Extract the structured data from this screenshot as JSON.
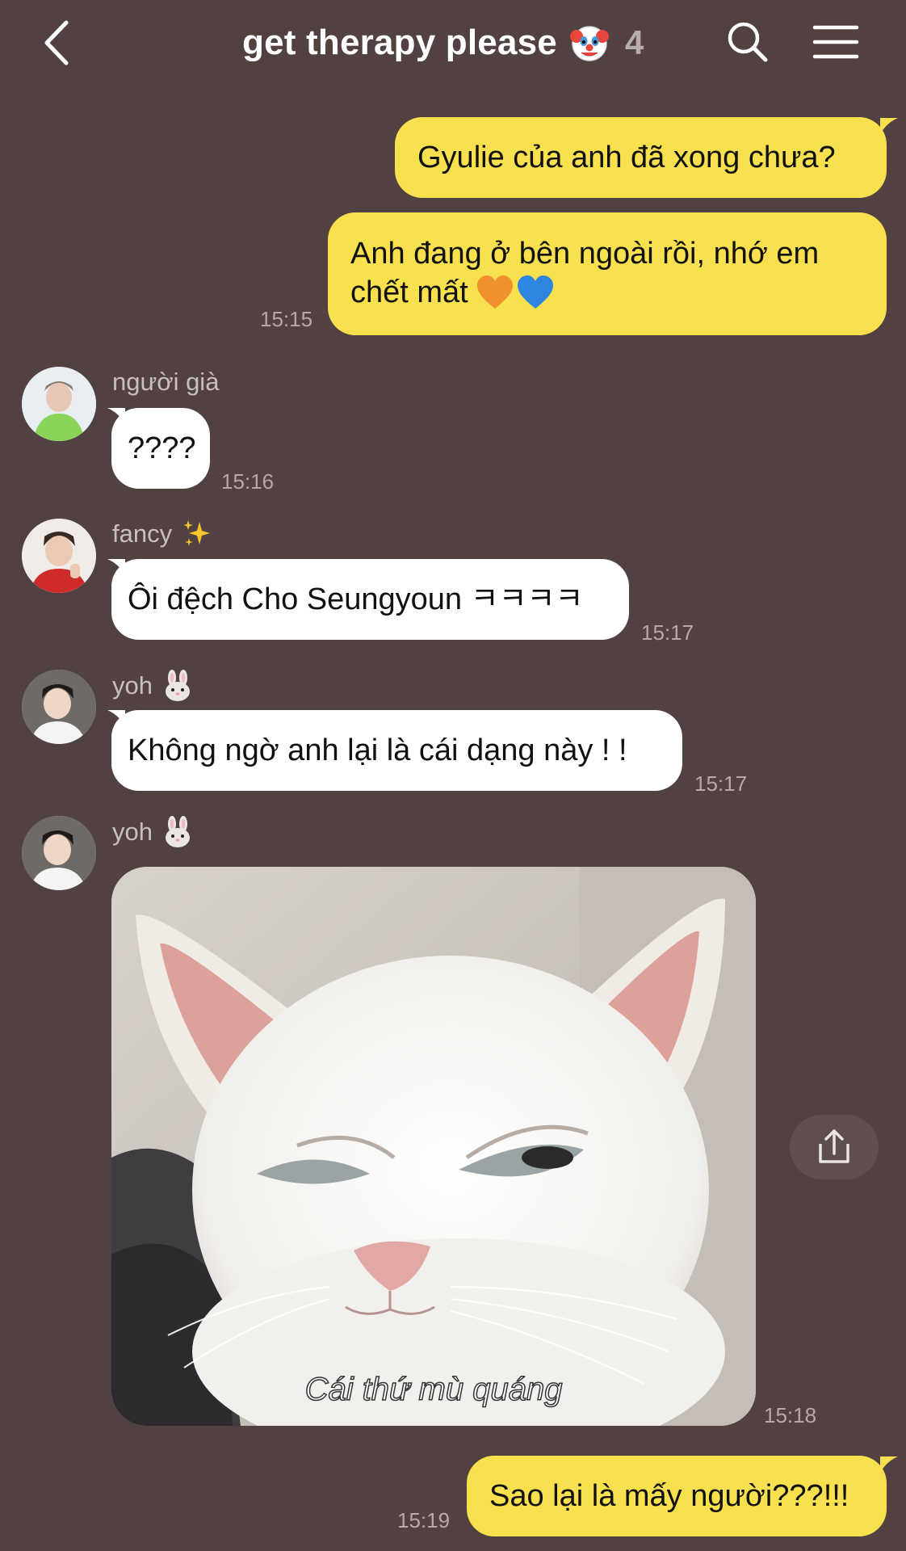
{
  "header": {
    "title": "get therapy please",
    "title_emoji": "clown-face-icon",
    "member_count": "4"
  },
  "messages": [
    {
      "direction": "out",
      "text": "Gyulie của anh đã xong chưa?"
    },
    {
      "direction": "out",
      "line1": "Anh đang ở bên ngoài rồi, nhớ em",
      "line2": "chết mất",
      "emojis": [
        "orange-heart-icon",
        "blue-heart-icon"
      ],
      "time": "15:15"
    },
    {
      "direction": "in",
      "sender": "người già",
      "text": "????",
      "time": "15:16"
    },
    {
      "direction": "in",
      "sender": "fancy",
      "sender_emoji": "sparkles-icon",
      "text": "Ôi đệch Cho Seungyoun ㅋㅋㅋㅋ",
      "time": "15:17"
    },
    {
      "direction": "in",
      "sender": "yoh",
      "sender_emoji": "rabbit-face-icon",
      "text": "Không ngờ anh lại là cái dạng này ! !",
      "time": "15:17"
    },
    {
      "direction": "in",
      "sender": "yoh",
      "sender_emoji": "rabbit-face-icon",
      "image_caption": "Cái thứ mù quáng",
      "time": "15:18"
    },
    {
      "direction": "out",
      "text": "Sao lại là mấy người???!!!",
      "time": "15:19"
    }
  ],
  "colors": {
    "background": "#514140",
    "outgoing_bubble": "#f8e04e",
    "incoming_bubble": "#ffffff"
  }
}
